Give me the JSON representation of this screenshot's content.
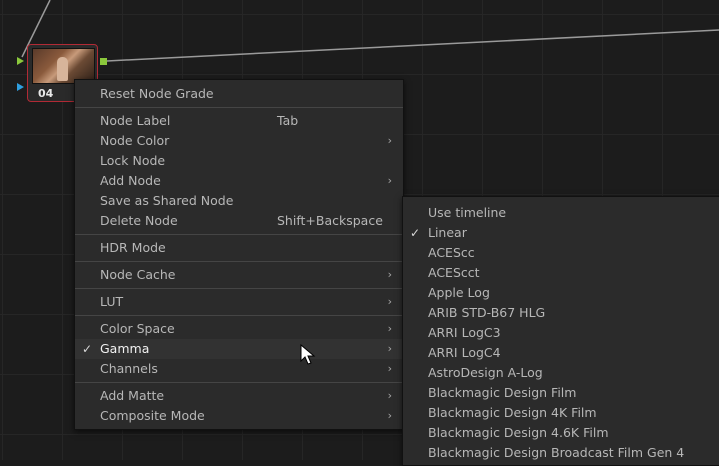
{
  "node": {
    "number": "04"
  },
  "context_menu": {
    "items": [
      {
        "label": "Reset Node Grade",
        "shortcut": "",
        "arrow": ""
      },
      {
        "label": "Node Label",
        "shortcut": "Tab",
        "arrow": ""
      },
      {
        "label": "Node Color",
        "shortcut": "",
        "arrow": "›"
      },
      {
        "label": "Lock Node",
        "shortcut": "",
        "arrow": ""
      },
      {
        "label": "Add Node",
        "shortcut": "",
        "arrow": "›"
      },
      {
        "label": "Save as Shared Node",
        "shortcut": "",
        "arrow": ""
      },
      {
        "label": "Delete Node",
        "shortcut": "Shift+Backspace",
        "arrow": ""
      },
      {
        "label": "HDR Mode",
        "shortcut": "",
        "arrow": ""
      },
      {
        "label": "Node Cache",
        "shortcut": "",
        "arrow": "›"
      },
      {
        "label": "LUT",
        "shortcut": "",
        "arrow": "›"
      },
      {
        "label": "Color Space",
        "shortcut": "",
        "arrow": "›"
      },
      {
        "label": "Gamma",
        "shortcut": "",
        "arrow": "›",
        "check": "✓"
      },
      {
        "label": "Channels",
        "shortcut": "",
        "arrow": "›"
      },
      {
        "label": "Add Matte",
        "shortcut": "",
        "arrow": "›"
      },
      {
        "label": "Composite Mode",
        "shortcut": "",
        "arrow": "›"
      }
    ]
  },
  "gamma_submenu": {
    "items": [
      {
        "label": "Use timeline"
      },
      {
        "label": "Linear",
        "check": "✓"
      },
      {
        "label": "ACEScc"
      },
      {
        "label": "ACEScct"
      },
      {
        "label": "Apple Log"
      },
      {
        "label": "ARIB STD-B67 HLG"
      },
      {
        "label": "ARRI LogC3"
      },
      {
        "label": "ARRI LogC4"
      },
      {
        "label": "AstroDesign A-Log"
      },
      {
        "label": "Blackmagic Design Film"
      },
      {
        "label": "Blackmagic Design 4K Film"
      },
      {
        "label": "Blackmagic Design 4.6K Film"
      },
      {
        "label": "Blackmagic Design Broadcast Film Gen 4"
      }
    ]
  },
  "colors": {
    "background": "#1c1c1c",
    "menu_bg": "#2b2b2b",
    "node_border": "#b12a35",
    "port_green": "#8bc83c",
    "port_blue": "#2f9fe0"
  },
  "icons": {
    "submenu_arrow": "chevron-right-icon",
    "check": "checkmark-icon",
    "cursor": "mouse-pointer-icon"
  }
}
